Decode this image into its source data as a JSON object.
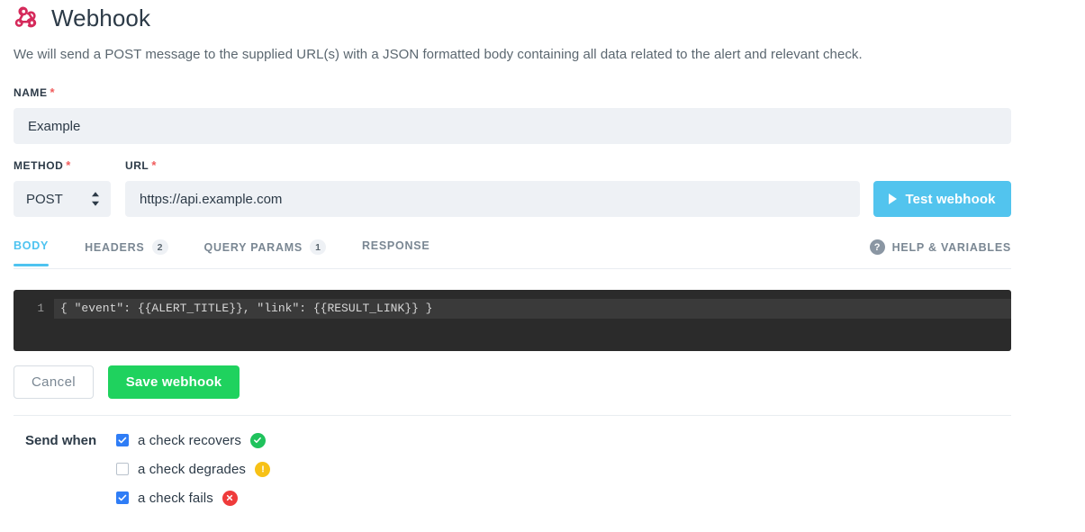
{
  "header": {
    "icon": "webhook-icon",
    "title": "Webhook",
    "description": "We will send a POST message to the supplied URL(s) with a JSON formatted body containing all data related to the alert and relevant check."
  },
  "form": {
    "name": {
      "label": "NAME",
      "required_marker": "*",
      "value": "Example",
      "placeholder": ""
    },
    "method": {
      "label": "METHOD",
      "required_marker": "*",
      "value": "POST",
      "options": [
        "POST"
      ]
    },
    "url": {
      "label": "URL",
      "required_marker": "*",
      "value": "https://api.example.com",
      "placeholder": ""
    },
    "test_button": {
      "label": "Test webhook",
      "icon": "play-icon",
      "color": "#52c4ee"
    }
  },
  "tabs": {
    "items": [
      {
        "label": "BODY",
        "badge": "",
        "active": true
      },
      {
        "label": "HEADERS",
        "badge": "2",
        "active": false
      },
      {
        "label": "QUERY PARAMS",
        "badge": "1",
        "active": false
      },
      {
        "label": "RESPONSE",
        "badge": "",
        "active": false
      }
    ],
    "active_color": "#4ec3f0",
    "help": {
      "label": "HELP & VARIABLES",
      "icon": "question-mark-icon",
      "glyph": "?"
    }
  },
  "editor": {
    "lines": [
      {
        "number": "1",
        "text": "{ \"event\": {{ALERT_TITLE}}, \"link\": {{RESULT_LINK}} }"
      }
    ],
    "background": "#2b2b2b"
  },
  "actions": {
    "cancel_label": "Cancel",
    "save_label": "Save webhook",
    "save_color": "#1fd25e"
  },
  "send_when": {
    "label": "Send when",
    "options": [
      {
        "label": "a check recovers",
        "checked": true,
        "status": "success",
        "status_color": "#1fc25c",
        "status_icon": "check-icon"
      },
      {
        "label": "a check degrades",
        "checked": false,
        "status": "warning",
        "status_color": "#f7c116",
        "status_icon": "exclamation-icon"
      },
      {
        "label": "a check fails",
        "checked": true,
        "status": "error",
        "status_color": "#ef3b3b",
        "status_icon": "close-icon"
      }
    ]
  }
}
